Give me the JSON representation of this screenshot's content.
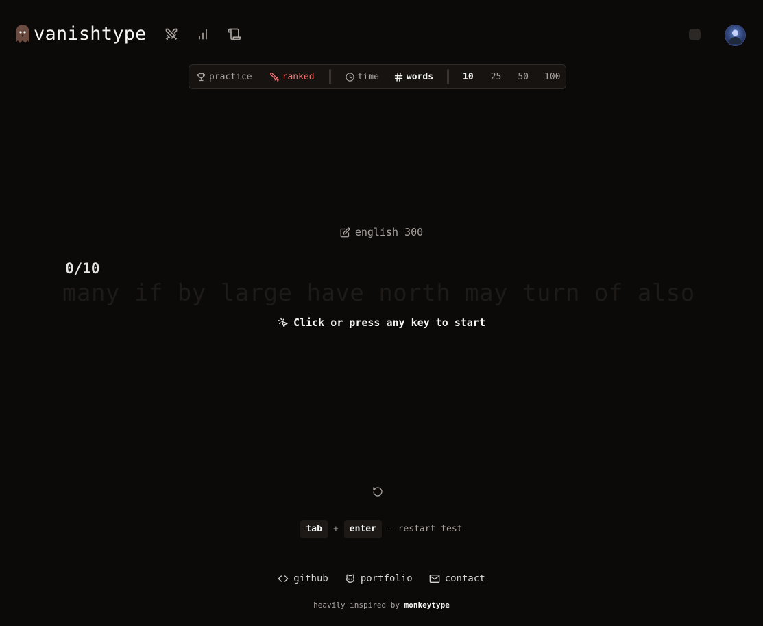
{
  "brand": {
    "name": "vanishtype",
    "logo_icon": "ghost-icon"
  },
  "header": {
    "nav_icons": [
      "swords-icon",
      "bar-chart-icon",
      "scroll-icon"
    ],
    "theme_toggle_icon": "theme-dot",
    "avatar_icon": "user-avatar"
  },
  "modebar": {
    "practice": "practice",
    "ranked": "ranked",
    "time": "time",
    "words": "words",
    "counts": [
      "10",
      "25",
      "50",
      "100"
    ],
    "selected_count": "10",
    "selected_mode": "words",
    "ranked_color": "#f87171"
  },
  "test": {
    "language": "english 300",
    "progress": "0/10",
    "words_text": "many if by large have north may turn of also",
    "start_hint": "Click or press any key to start"
  },
  "shortcut": {
    "key1": "tab",
    "plus": "+",
    "key2": "enter",
    "description": "- restart test"
  },
  "footer": {
    "github": "github",
    "portfolio": "portfolio",
    "contact": "contact",
    "credit_prefix": "heavily inspired by",
    "credit_link": "monkeytype"
  },
  "colors": {
    "background": "#0c0a09",
    "text": "#a8a29e",
    "highlight": "#f5f5f4",
    "accent": "#f87171"
  }
}
